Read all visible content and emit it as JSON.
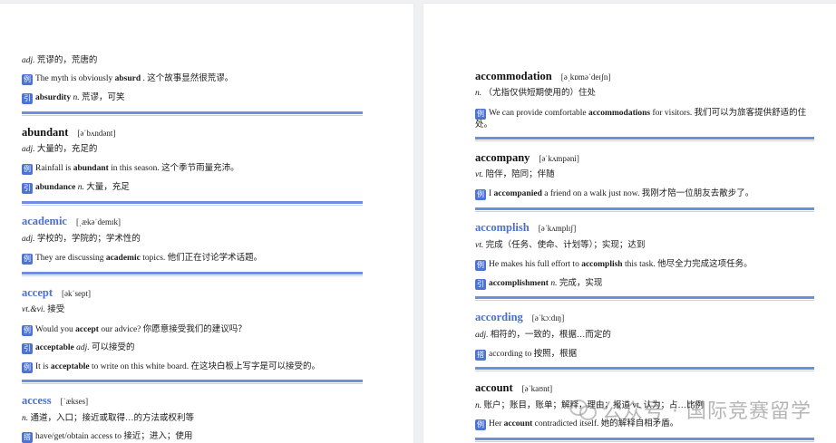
{
  "left_page": {
    "top_entry": {
      "definition": {
        "pos": "adj.",
        "text": " 荒谬的，荒唐的"
      },
      "example": {
        "badge": "例",
        "pre": "The myth is obviously ",
        "bold": "absurd",
        "post": " . 这个故事显然很荒谬。"
      },
      "derived": {
        "badge": "引",
        "bold": "absurdity",
        "pos": " n.",
        "text": " 荒谬，可笑"
      }
    },
    "abundant": {
      "headword": "abundant",
      "phonetic": "[əˈbʌndənt]",
      "definition": {
        "pos": "adj.",
        "text": " 大量的，充足的"
      },
      "example": {
        "badge": "例",
        "pre": "Rainfall is ",
        "bold": "abundant",
        "post": " in this season. 这个季节雨量充沛。"
      },
      "derived": {
        "badge": "引",
        "bold": "abundance",
        "pos": " n.",
        "text": " 大量，充足"
      }
    },
    "academic": {
      "headword": "academic",
      "phonetic": "[ˌækəˈdemɪk]",
      "definition": {
        "pos": "adj.",
        "text": " 学校的，学院的；学术性的"
      },
      "example": {
        "badge": "例",
        "pre": "They are discussing ",
        "bold": "academic",
        "post": " topics. 他们正在讨论学术话题。"
      }
    },
    "accept": {
      "headword": "accept",
      "phonetic": "[əkˈsept]",
      "definition": {
        "pos": "vt.&vi.",
        "text": " 接受"
      },
      "example1": {
        "badge": "例",
        "pre": "Would you ",
        "bold": "accept",
        "post": " our advice? 你愿意接受我们的建议吗？"
      },
      "derived": {
        "badge": "引",
        "bold": "acceptable",
        "pos": " adj.",
        "text": " 可以接受的"
      },
      "example2": {
        "badge": "例",
        "pre": "It is ",
        "bold": "acceptable",
        "post": " to write on this white board. 在这块白板上写字是可以接受的。"
      }
    },
    "access": {
      "headword": "access",
      "phonetic": "[ˈækses]",
      "definition": {
        "pos": "n.",
        "text": " 通道，入口；接近或取得…的方法或权利等"
      },
      "collocation": {
        "badge": "搭",
        "text": "have/get/obtain access to 接近；进入；使用"
      }
    }
  },
  "right_page": {
    "accommodation": {
      "headword": "accommodation",
      "phonetic": "[əˌkɒməˈdeɪʃn]",
      "definition": {
        "pos": "n.",
        "text": " （尤指仅供短期使用的）住处"
      },
      "example": {
        "badge": "例",
        "pre": "We can provide comfortable ",
        "bold": "accommodations",
        "post": " for visitors. 我们可以为旅客提供舒适的住处。"
      }
    },
    "accompany": {
      "headword": "accompany",
      "phonetic": "[əˈkʌmpəni]",
      "definition": {
        "pos": "vt.",
        "text": " 陪伴，陪同；伴随"
      },
      "example": {
        "badge": "例",
        "pre": "I ",
        "bold": "accompanied",
        "post": " a friend on a walk just now. 我刚才陪一位朋友去散步了。"
      }
    },
    "accomplish": {
      "headword": "accomplish",
      "phonetic": "[əˈkʌmplɪʃ]",
      "definition": {
        "pos": "vt.",
        "text": " 完成（任务、使命、计划等）；实现；达到"
      },
      "example": {
        "badge": "例",
        "pre": "He makes his full effort to ",
        "bold": "accomplish",
        "post": " this task. 他尽全力完成这项任务。"
      },
      "derived": {
        "badge": "引",
        "bold": "accomplishment",
        "pos": " n.",
        "text": " 完成，实现"
      }
    },
    "according": {
      "headword": "according",
      "phonetic": "[əˈkɔːdɪŋ]",
      "definition": {
        "pos": "adj.",
        "text": " 相符的，一致的，根据…而定的"
      },
      "collocation": {
        "badge": "搭",
        "text": "according to 按照，根据"
      }
    },
    "account": {
      "headword": "account",
      "phonetic": "[əˈkaʊnt]",
      "definition": {
        "pos": "n.",
        "text": " 账户；账目，账单；解释，理由；报道 vt. 认为；占…比例"
      },
      "example": {
        "badge": "例",
        "pre": "Her ",
        "bold": "account",
        "post": " contradicted itself. 她的解释自相矛盾。"
      }
    }
  },
  "watermark": {
    "text": "公众号 · 国际竞赛留学"
  },
  "colors": {
    "accent_blue": "#4a6fcf",
    "badge_blue": "#4d74d4",
    "divider": "#6f8ee0",
    "background": "#eef0f2"
  }
}
